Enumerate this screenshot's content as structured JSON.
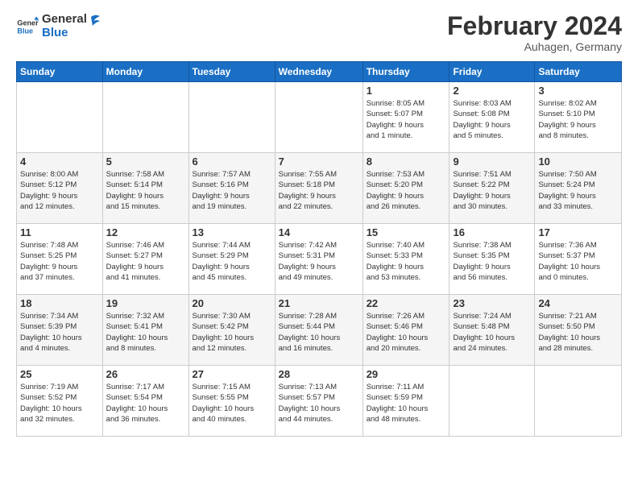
{
  "header": {
    "logo_line1": "General",
    "logo_line2": "Blue",
    "month": "February 2024",
    "location": "Auhagen, Germany"
  },
  "weekdays": [
    "Sunday",
    "Monday",
    "Tuesday",
    "Wednesday",
    "Thursday",
    "Friday",
    "Saturday"
  ],
  "weeks": [
    [
      {
        "day": "",
        "info": ""
      },
      {
        "day": "",
        "info": ""
      },
      {
        "day": "",
        "info": ""
      },
      {
        "day": "",
        "info": ""
      },
      {
        "day": "1",
        "info": "Sunrise: 8:05 AM\nSunset: 5:07 PM\nDaylight: 9 hours\nand 1 minute."
      },
      {
        "day": "2",
        "info": "Sunrise: 8:03 AM\nSunset: 5:08 PM\nDaylight: 9 hours\nand 5 minutes."
      },
      {
        "day": "3",
        "info": "Sunrise: 8:02 AM\nSunset: 5:10 PM\nDaylight: 9 hours\nand 8 minutes."
      }
    ],
    [
      {
        "day": "4",
        "info": "Sunrise: 8:00 AM\nSunset: 5:12 PM\nDaylight: 9 hours\nand 12 minutes."
      },
      {
        "day": "5",
        "info": "Sunrise: 7:58 AM\nSunset: 5:14 PM\nDaylight: 9 hours\nand 15 minutes."
      },
      {
        "day": "6",
        "info": "Sunrise: 7:57 AM\nSunset: 5:16 PM\nDaylight: 9 hours\nand 19 minutes."
      },
      {
        "day": "7",
        "info": "Sunrise: 7:55 AM\nSunset: 5:18 PM\nDaylight: 9 hours\nand 22 minutes."
      },
      {
        "day": "8",
        "info": "Sunrise: 7:53 AM\nSunset: 5:20 PM\nDaylight: 9 hours\nand 26 minutes."
      },
      {
        "day": "9",
        "info": "Sunrise: 7:51 AM\nSunset: 5:22 PM\nDaylight: 9 hours\nand 30 minutes."
      },
      {
        "day": "10",
        "info": "Sunrise: 7:50 AM\nSunset: 5:24 PM\nDaylight: 9 hours\nand 33 minutes."
      }
    ],
    [
      {
        "day": "11",
        "info": "Sunrise: 7:48 AM\nSunset: 5:25 PM\nDaylight: 9 hours\nand 37 minutes."
      },
      {
        "day": "12",
        "info": "Sunrise: 7:46 AM\nSunset: 5:27 PM\nDaylight: 9 hours\nand 41 minutes."
      },
      {
        "day": "13",
        "info": "Sunrise: 7:44 AM\nSunset: 5:29 PM\nDaylight: 9 hours\nand 45 minutes."
      },
      {
        "day": "14",
        "info": "Sunrise: 7:42 AM\nSunset: 5:31 PM\nDaylight: 9 hours\nand 49 minutes."
      },
      {
        "day": "15",
        "info": "Sunrise: 7:40 AM\nSunset: 5:33 PM\nDaylight: 9 hours\nand 53 minutes."
      },
      {
        "day": "16",
        "info": "Sunrise: 7:38 AM\nSunset: 5:35 PM\nDaylight: 9 hours\nand 56 minutes."
      },
      {
        "day": "17",
        "info": "Sunrise: 7:36 AM\nSunset: 5:37 PM\nDaylight: 10 hours\nand 0 minutes."
      }
    ],
    [
      {
        "day": "18",
        "info": "Sunrise: 7:34 AM\nSunset: 5:39 PM\nDaylight: 10 hours\nand 4 minutes."
      },
      {
        "day": "19",
        "info": "Sunrise: 7:32 AM\nSunset: 5:41 PM\nDaylight: 10 hours\nand 8 minutes."
      },
      {
        "day": "20",
        "info": "Sunrise: 7:30 AM\nSunset: 5:42 PM\nDaylight: 10 hours\nand 12 minutes."
      },
      {
        "day": "21",
        "info": "Sunrise: 7:28 AM\nSunset: 5:44 PM\nDaylight: 10 hours\nand 16 minutes."
      },
      {
        "day": "22",
        "info": "Sunrise: 7:26 AM\nSunset: 5:46 PM\nDaylight: 10 hours\nand 20 minutes."
      },
      {
        "day": "23",
        "info": "Sunrise: 7:24 AM\nSunset: 5:48 PM\nDaylight: 10 hours\nand 24 minutes."
      },
      {
        "day": "24",
        "info": "Sunrise: 7:21 AM\nSunset: 5:50 PM\nDaylight: 10 hours\nand 28 minutes."
      }
    ],
    [
      {
        "day": "25",
        "info": "Sunrise: 7:19 AM\nSunset: 5:52 PM\nDaylight: 10 hours\nand 32 minutes."
      },
      {
        "day": "26",
        "info": "Sunrise: 7:17 AM\nSunset: 5:54 PM\nDaylight: 10 hours\nand 36 minutes."
      },
      {
        "day": "27",
        "info": "Sunrise: 7:15 AM\nSunset: 5:55 PM\nDaylight: 10 hours\nand 40 minutes."
      },
      {
        "day": "28",
        "info": "Sunrise: 7:13 AM\nSunset: 5:57 PM\nDaylight: 10 hours\nand 44 minutes."
      },
      {
        "day": "29",
        "info": "Sunrise: 7:11 AM\nSunset: 5:59 PM\nDaylight: 10 hours\nand 48 minutes."
      },
      {
        "day": "",
        "info": ""
      },
      {
        "day": "",
        "info": ""
      }
    ]
  ]
}
